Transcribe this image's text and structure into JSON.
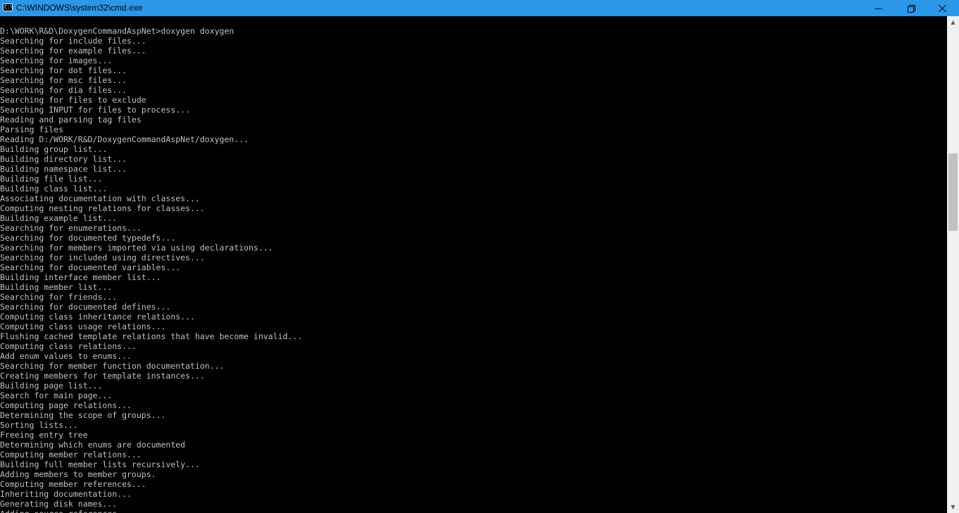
{
  "window": {
    "title": "C:\\WINDOWS\\system32\\cmd.exe",
    "icon": "cmd-icon",
    "icon_text": "C:\\",
    "controls": {
      "minimize": "minimize-icon",
      "maximize": "restore-icon",
      "close": "close-icon"
    },
    "colors": {
      "titlebar": "#2b97e8",
      "console_bg": "#000000",
      "console_text": "#c0c0c0"
    }
  },
  "console": {
    "lines": [
      "D:\\WORK\\R&D\\DoxygenCommandAspNet>doxygen doxygen",
      "Searching for include files...",
      "Searching for example files...",
      "Searching for images...",
      "Searching for dot files...",
      "Searching for msc files...",
      "Searching for dia files...",
      "Searching for files to exclude",
      "Searching INPUT for files to process...",
      "Reading and parsing tag files",
      "Parsing files",
      "Reading D:/WORK/R&D/DoxygenCommandAspNet/doxygen...",
      "Building group list...",
      "Building directory list...",
      "Building namespace list...",
      "Building file list...",
      "Building class list...",
      "Associating documentation with classes...",
      "Computing nesting relations for classes...",
      "Building example list...",
      "Searching for enumerations...",
      "Searching for documented typedefs...",
      "Searching for members imported via using declarations...",
      "Searching for included using directives...",
      "Searching for documented variables...",
      "Building interface member list...",
      "Building member list...",
      "Searching for friends...",
      "Searching for documented defines...",
      "Computing class inheritance relations...",
      "Computing class usage relations...",
      "Flushing cached template relations that have become invalid...",
      "Computing class relations...",
      "Add enum values to enums...",
      "Searching for member function documentation...",
      "Creating members for template instances...",
      "Building page list...",
      "Search for main page...",
      "Computing page relations...",
      "Determining the scope of groups...",
      "Sorting lists...",
      "Freeing entry tree",
      "Determining which enums are documented",
      "Computing member relations...",
      "Building full member lists recursively...",
      "Adding members to member groups.",
      "Computing member references...",
      "Inheriting documentation...",
      "Generating disk names...",
      "Adding source references..."
    ]
  },
  "scrollbar": {
    "up_icon": "scroll-up-icon",
    "down_icon": "scroll-down-icon",
    "up_glyph": "▲",
    "down_glyph": "▼"
  }
}
